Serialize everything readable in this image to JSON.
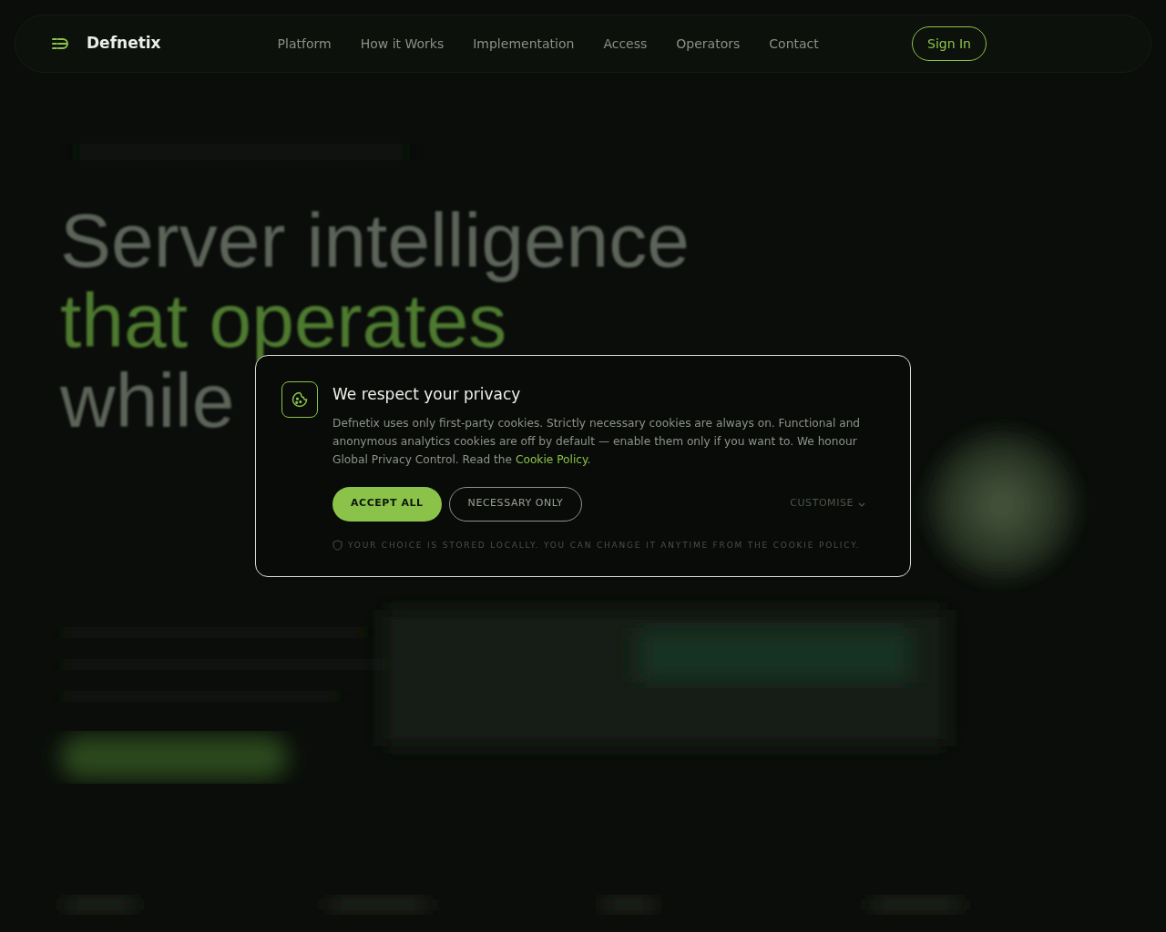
{
  "nav": {
    "brand": "Defnetix",
    "links": [
      {
        "label": "Platform"
      },
      {
        "label": "How it Works"
      },
      {
        "label": "Implementation"
      },
      {
        "label": "Access"
      },
      {
        "label": "Operators"
      },
      {
        "label": "Contact"
      }
    ],
    "sign_in": "Sign In"
  },
  "hero": {
    "headline": [
      {
        "text": "Server intelligence",
        "accent": false
      },
      {
        "text": "that operates",
        "accent": true
      },
      {
        "text": "while",
        "accent": false
      }
    ]
  },
  "cookie_dialog": {
    "title": "We respect your privacy",
    "body": "Defnetix uses only first-party cookies. Strictly necessary cookies are always on. Functional and anonymous analytics cookies are off by default — enable them only if you want to. We honour Global Privacy Control. Read the",
    "link": "Cookie Policy",
    "body_end": ".",
    "accept": "ACCEPT ALL",
    "necessary": "NECESSARY ONLY",
    "customise": "CUSTOMISE",
    "footnote": "YOUR CHOICE IS STORED LOCALLY. YOU CAN CHANGE IT ANYTIME FROM THE COOKIE POLICY."
  }
}
